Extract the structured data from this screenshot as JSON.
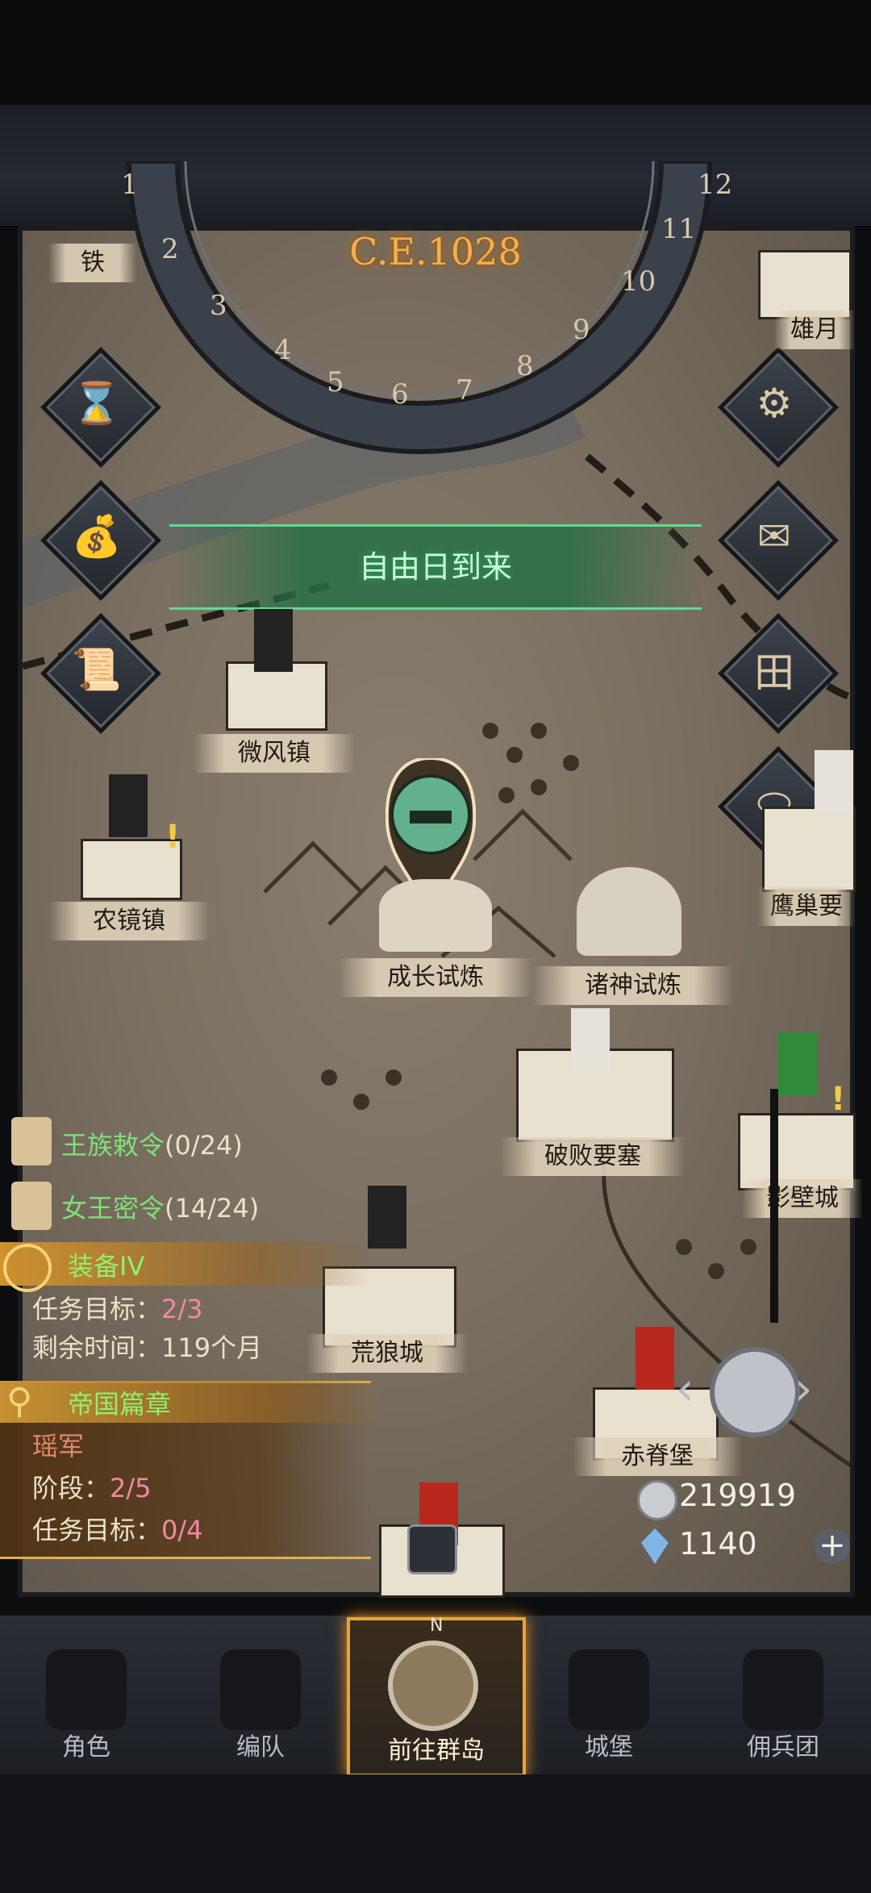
{
  "era": {
    "date": "C.E.1028",
    "months": [
      "1",
      "2",
      "3",
      "4",
      "5",
      "6",
      "7",
      "8",
      "9",
      "10",
      "11",
      "12"
    ]
  },
  "event_banner": "自由日到来",
  "locations": {
    "weifeng": "微风镇",
    "nongjing": "农镜镇",
    "chengzhang": "成长试炼",
    "zhushen": "诸神试炼",
    "pobai": "破败要塞",
    "yingbi": "鹰巢要",
    "yingbi_city": "影壁城",
    "huanglang": "荒狼城",
    "chiji": "赤脊堡",
    "xiongyue": "雄月",
    "tie": "铁"
  },
  "quests": {
    "royal": {
      "title": "王族敕令",
      "progress": "(0/24)"
    },
    "queen": {
      "title": "女王密令",
      "progress": "(14/24)"
    },
    "equip": {
      "title": "装备IV",
      "goal_label": "任务目标：",
      "goal_value": "2/3",
      "time_label": "剩余时间：",
      "time_value": "119个月"
    },
    "empire": {
      "title": "帝国篇章",
      "subtitle": "瑶军",
      "stage_label": "阶段：",
      "stage_value": "2/5",
      "goal_label": "任务目标：",
      "goal_value": "0/4"
    }
  },
  "resources": {
    "silver": "219919",
    "crystal": "1140"
  },
  "nav": {
    "role": "角色",
    "team": "编队",
    "islands": "前往群岛",
    "castle": "城堡",
    "merc": "佣兵团",
    "compass_n": "N"
  },
  "colors": {
    "accent_orange": "#e8a43a",
    "quest_green": "#7fe07a",
    "banner_green": "#58e08d"
  }
}
